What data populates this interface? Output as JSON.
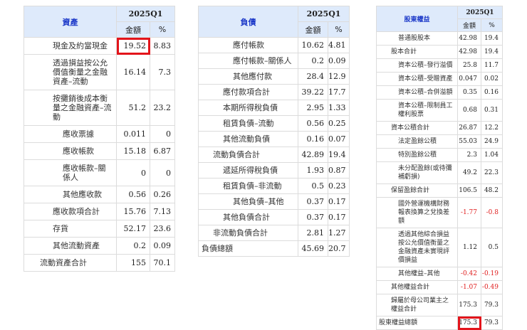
{
  "tables": [
    {
      "title": "資產",
      "period": "2025Q1",
      "col_amount": "金額",
      "col_pct": "%",
      "rows": [
        {
          "label": "現金及約當現金",
          "amount": "19.52",
          "pct": "8.83",
          "level": 1,
          "highlight": true
        },
        {
          "label": "透過損益按公允價值衡量之金融資產–流動",
          "amount": "16.14",
          "pct": "7.3",
          "level": 1
        },
        {
          "label": "按攤銷後成本衡量之金融資產–流動",
          "amount": "51.2",
          "pct": "23.2",
          "level": 1
        },
        {
          "label": "應收票據",
          "amount": "0.011",
          "pct": "0",
          "level": 2
        },
        {
          "label": "應收帳款",
          "amount": "15.18",
          "pct": "6.87",
          "level": 2
        },
        {
          "label": "應收帳款–關係人",
          "amount": "0",
          "pct": "0",
          "level": 2
        },
        {
          "label": "其他應收款",
          "amount": "0.56",
          "pct": "0.26",
          "level": 2
        },
        {
          "label": "應收款項合計",
          "amount": "15.76",
          "pct": "7.13",
          "level": 1
        },
        {
          "label": "存貨",
          "amount": "52.17",
          "pct": "23.6",
          "level": 1
        },
        {
          "label": "其他流動資產",
          "amount": "0.2",
          "pct": "0.09",
          "level": 1
        },
        {
          "label": "流動資產合計",
          "amount": "155",
          "pct": "70.1",
          "level": 0
        }
      ]
    },
    {
      "title": "負債",
      "period": "2025Q1",
      "col_amount": "金額",
      "col_pct": "%",
      "rows": [
        {
          "label": "應付帳款",
          "amount": "10.62",
          "pct": "4.81",
          "level": 2
        },
        {
          "label": "應付帳款–關係人",
          "amount": "0.2",
          "pct": "0.09",
          "level": 2
        },
        {
          "label": "其他應付款",
          "amount": "28.4",
          "pct": "12.9",
          "level": 2
        },
        {
          "label": "應付款項合計",
          "amount": "39.22",
          "pct": "17.7",
          "level": 1
        },
        {
          "label": "本期所得稅負債",
          "amount": "2.95",
          "pct": "1.33",
          "level": 1
        },
        {
          "label": "租賃負債–流動",
          "amount": "0.56",
          "pct": "0.25",
          "level": 1
        },
        {
          "label": "其他流動負債",
          "amount": "0.16",
          "pct": "0.07",
          "level": 1
        },
        {
          "label": "流動負債合計",
          "amount": "42.89",
          "pct": "19.4",
          "level": 0
        },
        {
          "label": "遞延所得稅負債",
          "amount": "1.93",
          "pct": "0.87",
          "level": 1
        },
        {
          "label": "租賃負債–非流動",
          "amount": "0.5",
          "pct": "0.23",
          "level": 1
        },
        {
          "label": "其他負債–其他",
          "amount": "0.37",
          "pct": "0.17",
          "level": 2
        },
        {
          "label": "其他負債合計",
          "amount": "0.37",
          "pct": "0.17",
          "level": 1
        },
        {
          "label": "非流動負債合計",
          "amount": "2.81",
          "pct": "1.27",
          "level": 0
        },
        {
          "label": "負債總額",
          "amount": "45.69",
          "pct": "20.7",
          "level": -1
        }
      ]
    },
    {
      "title": "股東權益",
      "period": "2025Q1",
      "col_amount": "金額",
      "col_pct": "%",
      "rows": [
        {
          "label": "普通股股本",
          "amount": "42.98",
          "pct": "19.4",
          "level": 2
        },
        {
          "label": "股本合計",
          "amount": "42.98",
          "pct": "19.4",
          "level": 1
        },
        {
          "label": "資本公積–發行溢價",
          "amount": "25.8",
          "pct": "11.7",
          "level": 2
        },
        {
          "label": "資本公積–受贈資產",
          "amount": "0.047",
          "pct": "0.02",
          "level": 2
        },
        {
          "label": "資本公積–合併溢額",
          "amount": "0.35",
          "pct": "0.16",
          "level": 2
        },
        {
          "label": "資本公積–限制員工權利股票",
          "amount": "0.68",
          "pct": "0.31",
          "level": 2
        },
        {
          "label": "資本公積合計",
          "amount": "26.87",
          "pct": "12.2",
          "level": 1
        },
        {
          "label": "法定盈餘公積",
          "amount": "55.03",
          "pct": "24.9",
          "level": 2
        },
        {
          "label": "特別盈餘公積",
          "amount": "2.3",
          "pct": "1.04",
          "level": 2
        },
        {
          "label": "未分配盈餘(或待彌補虧損)",
          "amount": "49.2",
          "pct": "22.3",
          "level": 2
        },
        {
          "label": "保留盈餘合計",
          "amount": "106.5",
          "pct": "48.2",
          "level": 1
        },
        {
          "label": "國外營運機構財務報表換算之兌換差額",
          "amount": "-1.77",
          "pct": "-0.8",
          "level": 2,
          "negative": true
        },
        {
          "label": "透過其他綜合損益按公允價值衡量之金融資產未實現評價損益",
          "amount": "1.12",
          "pct": "0.5",
          "level": 2
        },
        {
          "label": "其他權益–其他",
          "amount": "-0.42",
          "pct": "-0.19",
          "level": 2,
          "negative": true
        },
        {
          "label": "其他權益合計",
          "amount": "-1.07",
          "pct": "-0.49",
          "level": 1,
          "negative": true
        },
        {
          "label": "歸屬於母公司業主之權益合計",
          "amount": "175.3",
          "pct": "79.3",
          "level": 1
        },
        {
          "label": "股東權益總額",
          "amount": "175.3",
          "pct": "79.3",
          "level": -1,
          "highlight": true
        }
      ]
    }
  ]
}
